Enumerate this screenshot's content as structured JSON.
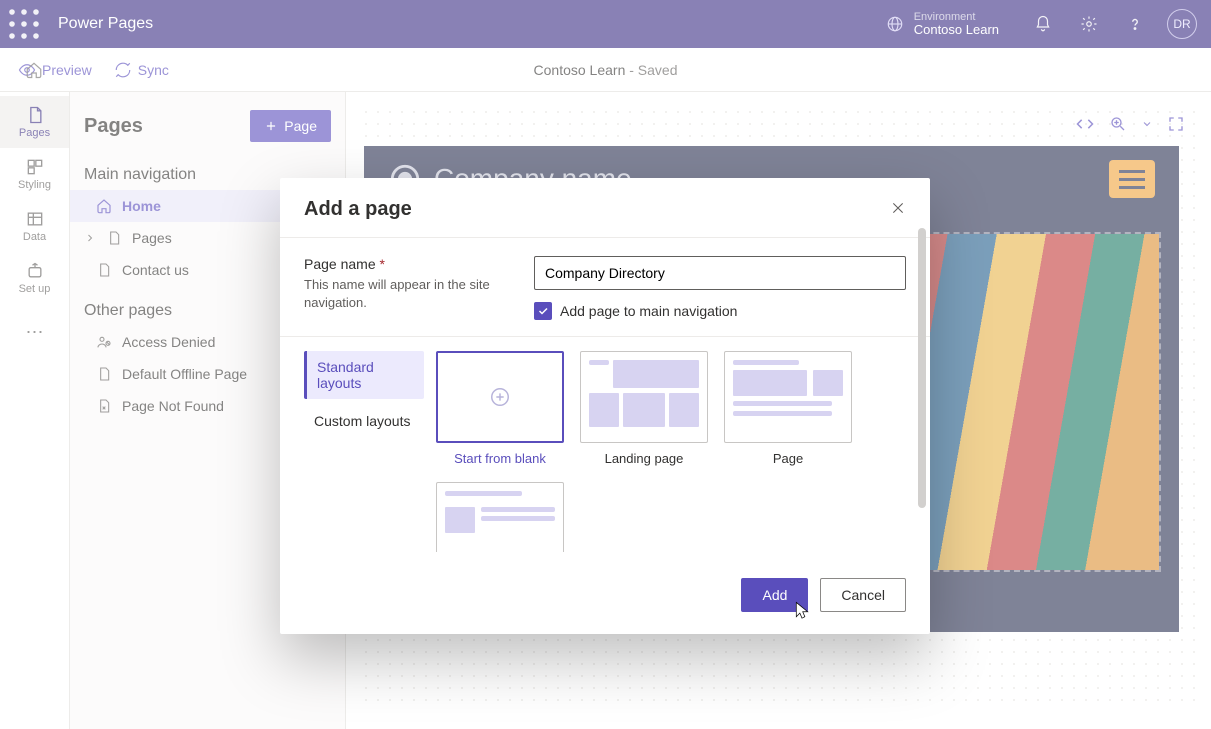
{
  "topbar": {
    "app_title": "Power Pages",
    "env_label": "Environment",
    "env_name": "Contoso Learn",
    "avatar_initials": "DR"
  },
  "subheader": {
    "site_name": "Contoso Learn",
    "status_suffix": " - Saved",
    "preview": "Preview",
    "sync": "Sync"
  },
  "rail": {
    "pages": "Pages",
    "styling": "Styling",
    "data": "Data",
    "setup": "Set up"
  },
  "pages_panel": {
    "title": "Pages",
    "add_button": "Page",
    "section_main": "Main navigation",
    "section_other": "Other pages",
    "main_items": [
      {
        "label": "Home",
        "active": true
      },
      {
        "label": "Pages"
      },
      {
        "label": "Contact us"
      }
    ],
    "other_items": [
      {
        "label": "Access Denied"
      },
      {
        "label": "Default Offline Page"
      },
      {
        "label": "Page Not Found"
      }
    ]
  },
  "site_preview": {
    "brand": "Company name"
  },
  "modal": {
    "title": "Add a page",
    "field_label": "Page name",
    "field_required_marker": "*",
    "field_hint": "This name will appear in the site navigation.",
    "input_value": "Company Directory",
    "checkbox_label": "Add page to main navigation",
    "tab_standard": "Standard layouts",
    "tab_custom": "Custom layouts",
    "layouts": [
      {
        "label": "Start from blank",
        "selected": true
      },
      {
        "label": "Landing page"
      },
      {
        "label": "Page"
      }
    ],
    "add_btn": "Add",
    "cancel_btn": "Cancel"
  }
}
